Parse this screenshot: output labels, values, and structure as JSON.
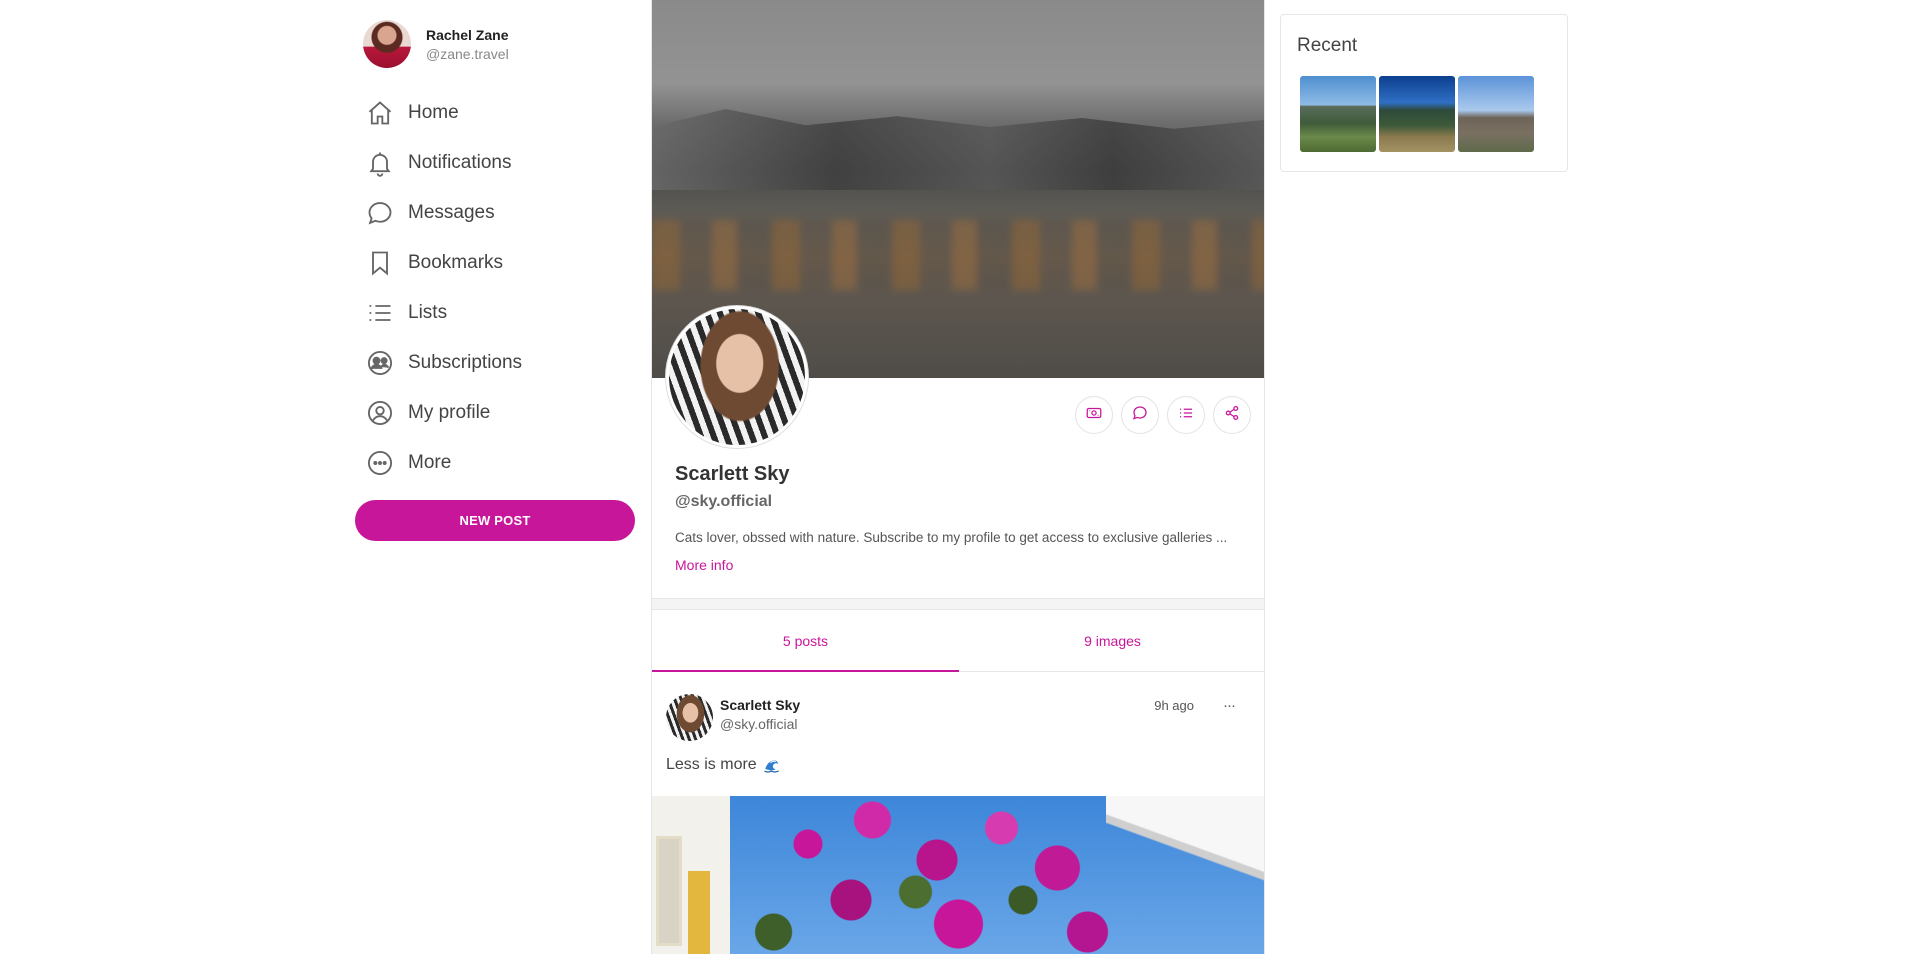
{
  "user": {
    "name": "Rachel Zane",
    "handle": "@zane.travel"
  },
  "nav": {
    "items": [
      {
        "label": "Home",
        "icon": "home-icon"
      },
      {
        "label": "Notifications",
        "icon": "bell-icon"
      },
      {
        "label": "Messages",
        "icon": "chat-icon"
      },
      {
        "label": "Bookmarks",
        "icon": "bookmark-icon"
      },
      {
        "label": "Lists",
        "icon": "list-icon"
      },
      {
        "label": "Subscriptions",
        "icon": "users-icon"
      },
      {
        "label": "My profile",
        "icon": "user-circle-icon"
      },
      {
        "label": "More",
        "icon": "more-circle-icon"
      }
    ],
    "new_post_label": "NEW POST"
  },
  "profile": {
    "name": "Scarlett Sky",
    "handle": "@sky.official",
    "bio": "Cats lover, obssed with nature. Subscribe to my profile to get access to exclusive galleries ...",
    "more_info_label": "More info",
    "actions": [
      "tip-icon",
      "chat-icon",
      "list-icon",
      "share-icon"
    ]
  },
  "tabs": [
    {
      "label": "5 posts",
      "active": true
    },
    {
      "label": "9 images",
      "active": false
    }
  ],
  "post": {
    "author_name": "Scarlett Sky",
    "author_handle": "@sky.official",
    "time": "9h ago",
    "menu": "···",
    "text": "Less is more"
  },
  "recent": {
    "title": "Recent",
    "thumbnails": [
      "mountain-thumb-1",
      "mountain-thumb-2",
      "mountain-thumb-3"
    ]
  },
  "colors": {
    "accent": "#c8169a",
    "text": "#333333",
    "border": "#e6e6e6"
  }
}
